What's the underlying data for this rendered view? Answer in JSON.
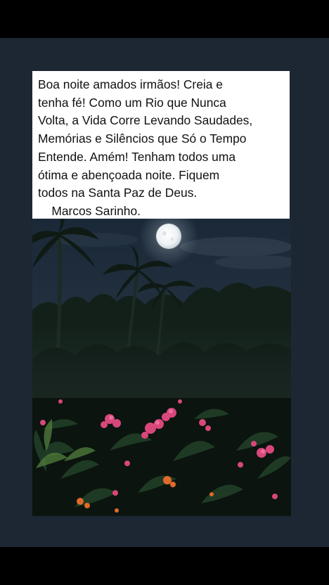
{
  "message": {
    "text": "Boa noite amados irmãos! Creia e\ntenha fé! Como um Rio que Nunca\nVolta, a Vida Corre Levando Saudades,\nMemórias e Silêncios que Só o Tempo\nEntende. Amém! Tenham todos uma\nótima e abençoada noite. Fiquem\ntodos na Santa Paz de Deus.\n    Marcos Sarinho."
  },
  "photo": {
    "subject": "night-garden-full-moon",
    "icons": [
      "moon-icon"
    ]
  },
  "colors": {
    "page_background": "#1c2733",
    "bars": "#000000",
    "card_background": "#ffffff",
    "text": "#111111",
    "flowers_pink": "#d8477c",
    "flowers_orange": "#e06a2a"
  }
}
